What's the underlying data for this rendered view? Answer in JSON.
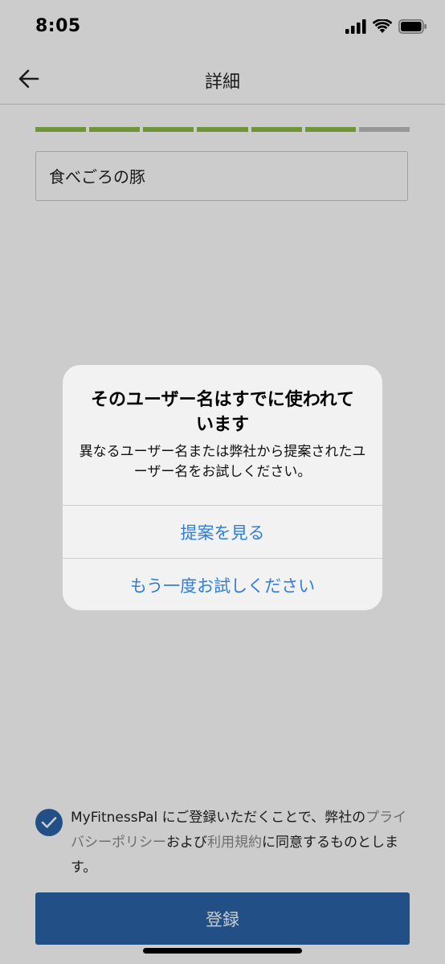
{
  "status_bar": {
    "time": "8:05"
  },
  "nav": {
    "title": "詳細",
    "back_icon": "arrow-left-icon"
  },
  "progress": {
    "completed_steps": 6,
    "total_steps": 7,
    "done_color": "#8db948",
    "pending_color": "#bdbdbd"
  },
  "username_field": {
    "value": "食べごろの豚"
  },
  "alert": {
    "title": "そのユーザー名はすでに使われています",
    "message": "異なるユーザー名または弊社から提案されたユーザー名をお試しください。",
    "actions": [
      {
        "label": "提案を見る"
      },
      {
        "label": "もう一度お試しください"
      }
    ],
    "action_color": "#2f7ed8"
  },
  "consent": {
    "checked": true,
    "text_prefix": "MyFitnessPal にご登録いただくことで、弊社の",
    "privacy_link": "プライバシーポリシー",
    "text_middle": "および",
    "terms_link": "利用規約",
    "text_suffix": "に同意するものとします。"
  },
  "register_button": {
    "label": "登録",
    "color": "#2a63a8"
  }
}
